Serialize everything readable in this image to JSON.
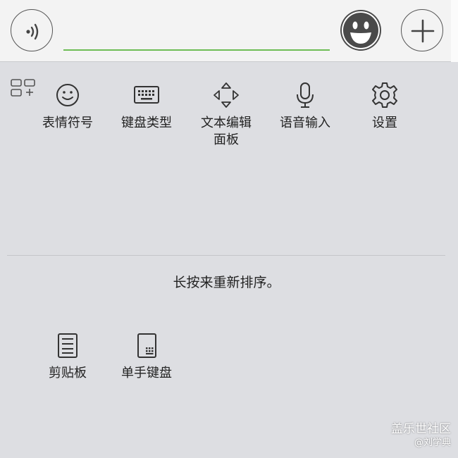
{
  "input": {
    "value": "",
    "placeholder": ""
  },
  "topbar": {
    "left_icon": "voice-wave-icon",
    "emoji_icon": "smiley-face-icon",
    "plus_icon": "plus-icon"
  },
  "toolbar": {
    "grid_icon": "add-grid-icon",
    "items": [
      {
        "label": "表情符号",
        "icon": "smiley-icon"
      },
      {
        "label": "键盘类型",
        "icon": "keyboard-icon"
      },
      {
        "label": "文本编辑面板",
        "icon": "move-arrows-icon"
      },
      {
        "label": "语音输入",
        "icon": "microphone-icon"
      },
      {
        "label": "设置",
        "icon": "gear-icon"
      }
    ]
  },
  "hint": "长按来重新排序。",
  "spare_items": [
    {
      "label": "剪贴板",
      "icon": "clipboard-icon"
    },
    {
      "label": "单手键盘",
      "icon": "one-hand-keyboard-icon"
    }
  ],
  "watermark": {
    "title": "盖乐世社区",
    "subtitle": "@刘学典"
  },
  "colors": {
    "accent": "#6dbd55",
    "background": "#dddee2",
    "topbar": "#f3f3f3"
  }
}
